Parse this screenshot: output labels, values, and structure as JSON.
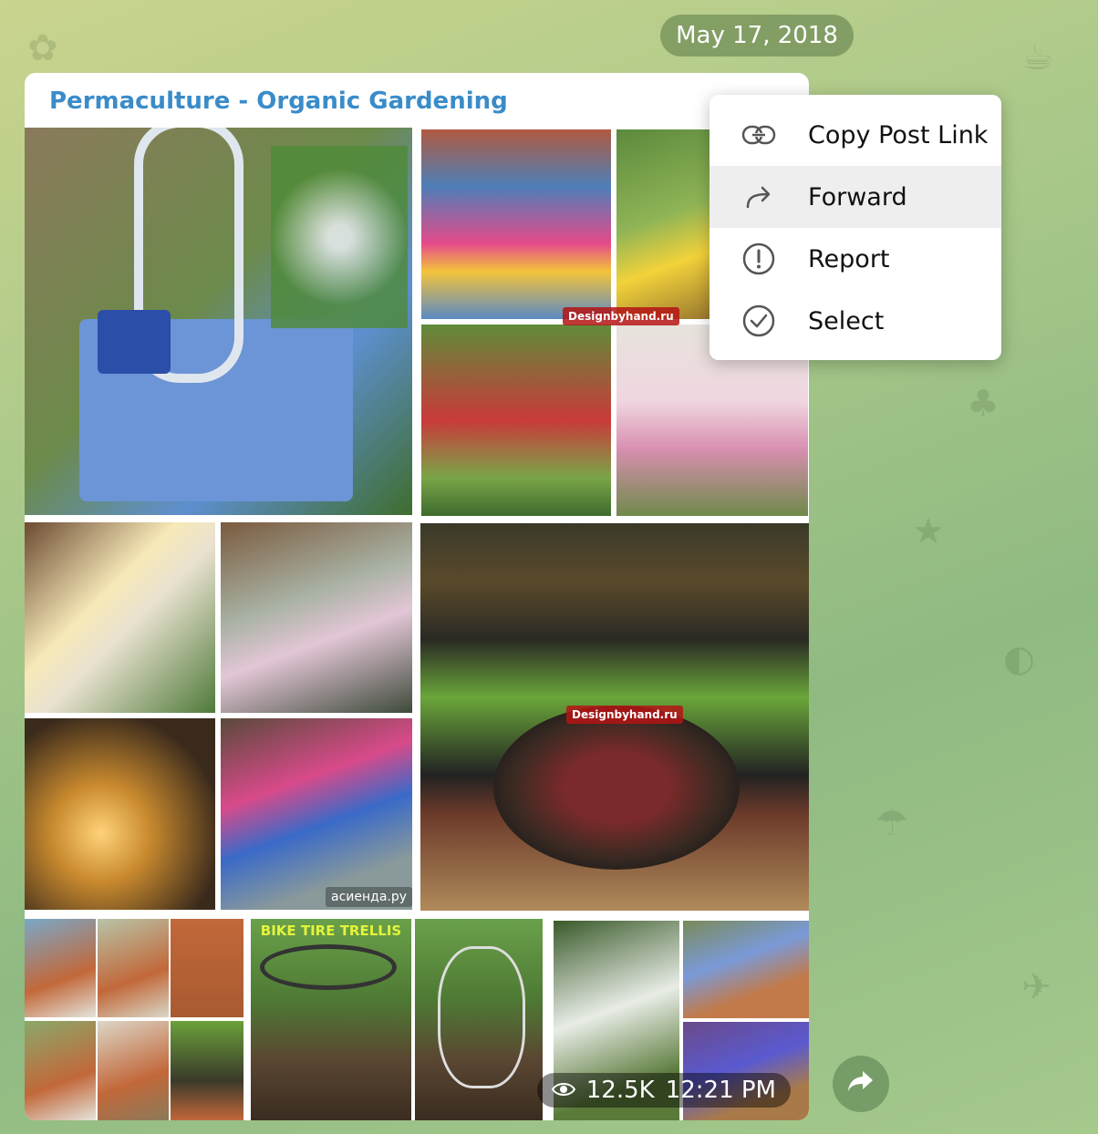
{
  "date": "May 17, 2018",
  "post": {
    "channel_name": "Permaculture - Organic Gardening",
    "watermark": "Designbyhand.ru",
    "watermark2": "асиенда.ру",
    "trellis_title": "BIKE TIRE TRELLIS",
    "views": "12.5K",
    "time": "12:21 PM"
  },
  "menu": {
    "items": [
      {
        "label": "Copy Post Link",
        "icon": "link-icon"
      },
      {
        "label": "Forward",
        "icon": "forward-arrow-icon"
      },
      {
        "label": "Report",
        "icon": "exclamation-icon"
      },
      {
        "label": "Select",
        "icon": "check-circle-icon"
      }
    ]
  }
}
